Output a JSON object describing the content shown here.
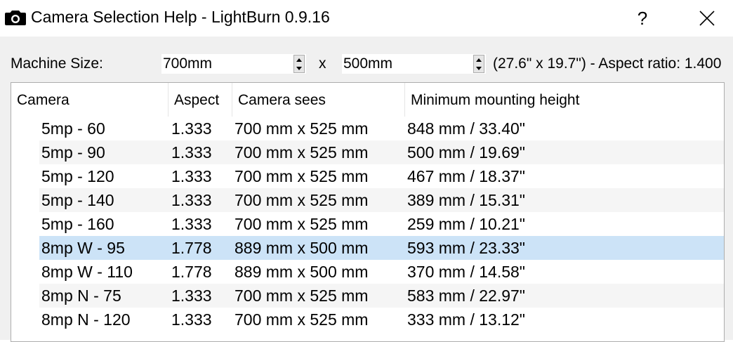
{
  "window": {
    "title": "Camera Selection Help - LightBurn 0.9.16",
    "help_glyph": "?",
    "icon": "camera-icon"
  },
  "machine_size": {
    "label": "Machine Size:",
    "width_value": "700mm",
    "separator": "x",
    "height_value": "500mm",
    "info": "(27.6\" x 19.7\") - Aspect ratio: 1.400"
  },
  "table": {
    "columns": [
      "Camera",
      "Aspect",
      "Camera sees",
      "Minimum mounting height"
    ],
    "selected_row": 5,
    "rows": [
      {
        "camera": "5mp - 60",
        "aspect": "1.333",
        "sees": "700 mm x 525 mm",
        "min_height": "848 mm / 33.40\""
      },
      {
        "camera": "5mp - 90",
        "aspect": "1.333",
        "sees": "700 mm x 525 mm",
        "min_height": "500 mm / 19.69\""
      },
      {
        "camera": "5mp - 120",
        "aspect": "1.333",
        "sees": "700 mm x 525 mm",
        "min_height": "467 mm / 18.37\""
      },
      {
        "camera": "5mp - 140",
        "aspect": "1.333",
        "sees": "700 mm x 525 mm",
        "min_height": "389 mm / 15.31\""
      },
      {
        "camera": "5mp - 160",
        "aspect": "1.333",
        "sees": "700 mm x 525 mm",
        "min_height": "259 mm / 10.21\""
      },
      {
        "camera": "8mp W - 95",
        "aspect": "1.778",
        "sees": "889 mm x 500 mm",
        "min_height": "593 mm / 23.33\""
      },
      {
        "camera": "8mp W - 110",
        "aspect": "1.778",
        "sees": "889 mm x 500 mm",
        "min_height": "370 mm / 14.58\""
      },
      {
        "camera": "8mp N - 75",
        "aspect": "1.333",
        "sees": "700 mm x 525 mm",
        "min_height": "583 mm / 22.97\""
      },
      {
        "camera": "8mp N - 120",
        "aspect": "1.333",
        "sees": "700 mm x 525 mm",
        "min_height": "333 mm / 13.12\""
      }
    ]
  },
  "colors": {
    "selection": "#cce3f7",
    "alt_row": "#f5f5f5",
    "dialog_bg": "#f0f0f0"
  }
}
